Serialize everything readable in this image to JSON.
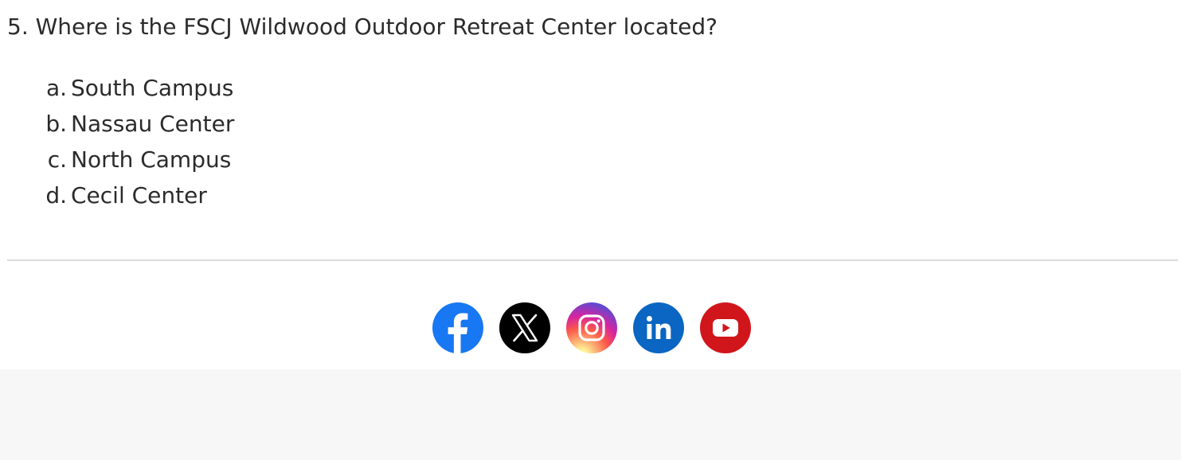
{
  "quiz": {
    "question": "5. Where is the FSCJ Wildwood Outdoor Retreat Center located?",
    "options": [
      {
        "marker": "a.",
        "text": "South Campus"
      },
      {
        "marker": "b.",
        "text": "Nassau Center"
      },
      {
        "marker": "c.",
        "text": "North Campus"
      },
      {
        "marker": "d.",
        "text": "Cecil Center"
      }
    ]
  },
  "social": {
    "links": [
      {
        "icon": "facebook-icon",
        "color": "#1877f2"
      },
      {
        "icon": "x-icon",
        "color": "#000000"
      },
      {
        "icon": "instagram-icon",
        "color": "#d6249f"
      },
      {
        "icon": "linkedin-icon",
        "color": "#0a66c2"
      },
      {
        "icon": "youtube-icon",
        "color": "#d0161b"
      }
    ]
  }
}
